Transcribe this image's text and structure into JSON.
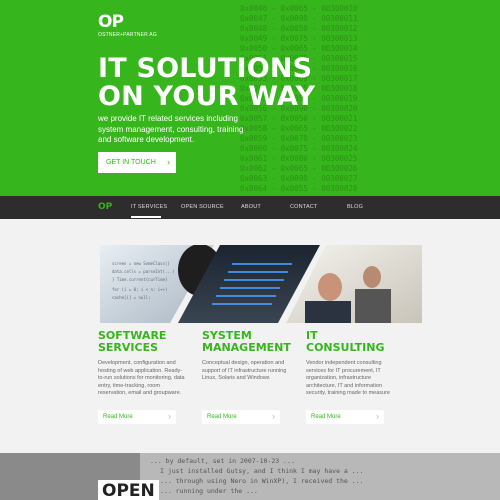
{
  "hero": {
    "logo_mark": "OP",
    "logo_sub": "OSTNER+PARTNER AG",
    "headline_line1": "IT SOLUTIONS",
    "headline_line2": "ON YOUR WAY",
    "lead": "we provide IT related services including system management, consulting, training and software development.",
    "cta_label": "GET IN TOUCH",
    "bg_color": "#37b51c"
  },
  "nav": {
    "brand": "OP",
    "items": [
      "IT SERVICES",
      "OPEN SOURCE",
      "ABOUT",
      "CONTACT",
      "BLOG"
    ],
    "active": "IT SERVICES"
  },
  "services": [
    {
      "title_l1": "SOFTWARE",
      "title_l2": "SERVICES",
      "text": "Development, configuration and hosting of web application. Ready-to-run solutions for monitoring, data entry, time-tracking, room reservation, email and groupware.",
      "button": "Read More"
    },
    {
      "title_l1": "SYSTEM",
      "title_l2": "MANAGEMENT",
      "text": "Conceptual design, operation and support of IT infrastructure running Linux, Solaris and Windows",
      "button": "Read More"
    },
    {
      "title_l1": "IT",
      "title_l2": "CONSULTING",
      "text": "Vendor independent consulting services for IT procurement, IT organization, infrastructure architecture, IT and information security, training made to measure",
      "button": "Read More"
    }
  ],
  "bottom": {
    "open_label": "OPEN"
  },
  "colors": {
    "accent": "#37b51c",
    "nav_bg": "#2d2d2d",
    "text_gray": "#666666"
  }
}
